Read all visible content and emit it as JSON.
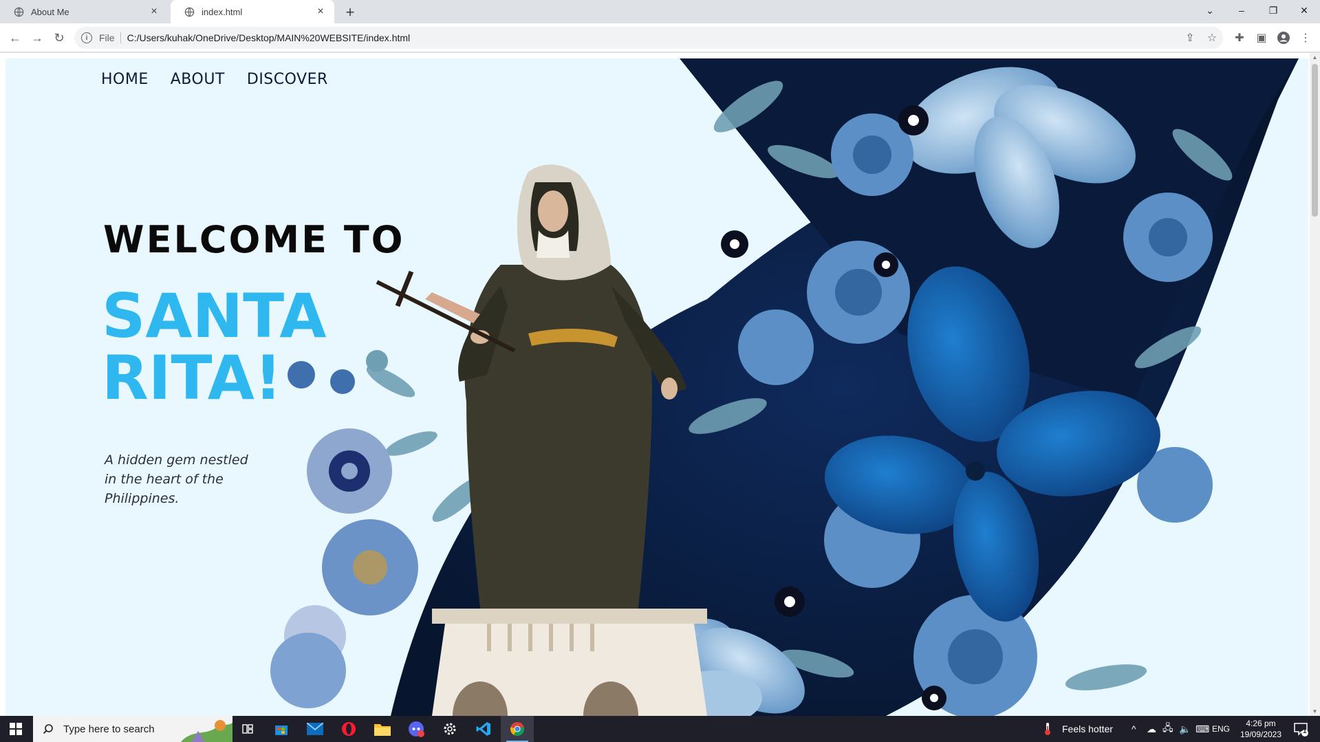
{
  "browser": {
    "tabs": [
      {
        "title": "About Me",
        "active": false
      },
      {
        "title": "index.html",
        "active": true
      }
    ],
    "address": {
      "scheme_label": "File",
      "url": "C:/Users/kuhak/OneDrive/Desktop/MAIN%20WEBSITE/index.html"
    }
  },
  "site": {
    "nav": [
      "HOME",
      "ABOUT",
      "DISCOVER"
    ],
    "hero": {
      "welcome": "WELCOME TO",
      "title_line1": "SANTA",
      "title_line2": "RITA!",
      "tagline": "A hidden gem nestled in the heart of the Philippines."
    },
    "colors": {
      "title": "#2fb8f0",
      "background": "#e8f8fe",
      "navy_shape": "#0b1f4a",
      "flower": "#2f6db0"
    }
  },
  "taskbar": {
    "search_placeholder": "Type here to search",
    "weather": "Feels hotter",
    "language": "ENG",
    "time": "4:26 pm",
    "date": "19/09/2023",
    "notification_count": "1",
    "apps": [
      "task-view",
      "microsoft-store",
      "mail",
      "opera",
      "file-explorer",
      "discord",
      "settings",
      "vscode",
      "chrome"
    ]
  }
}
